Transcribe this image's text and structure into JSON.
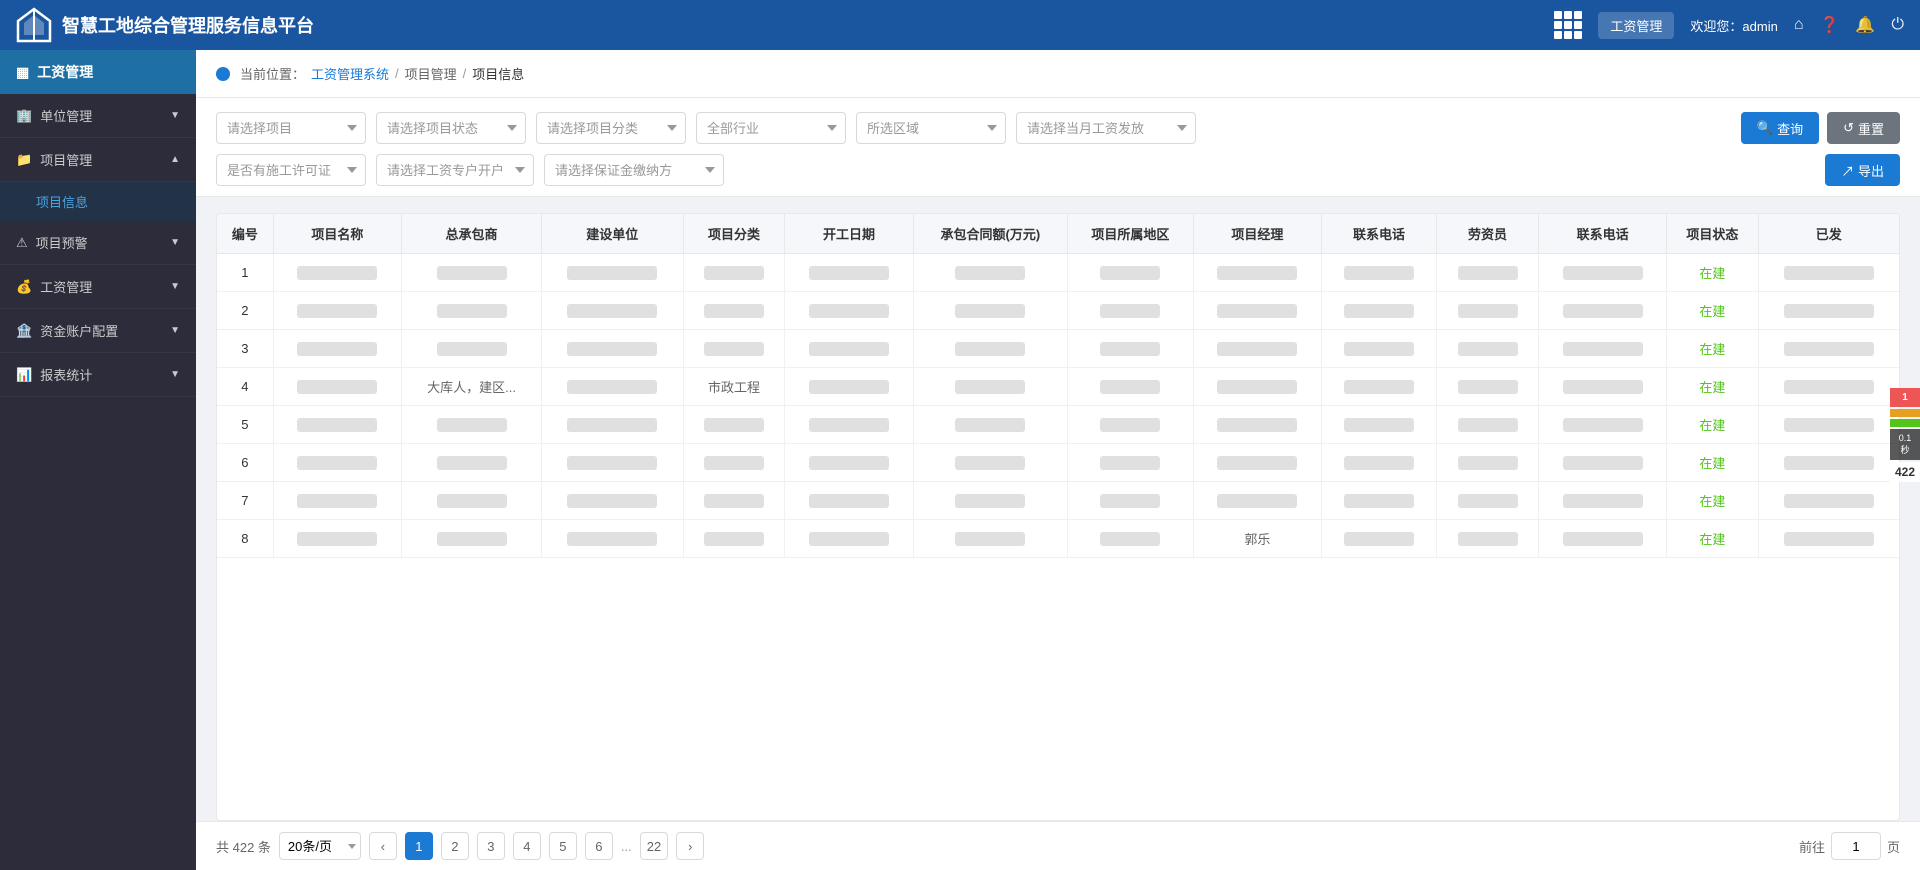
{
  "header": {
    "title": "智慧工地综合管理服务信息平台",
    "module_label": "工资管理",
    "welcome": "欢迎您：admin"
  },
  "sidebar": {
    "top_label": "工资管理",
    "items": [
      {
        "id": "unit-mgmt",
        "label": "单位管理",
        "icon": "building",
        "has_sub": true,
        "expanded": false
      },
      {
        "id": "project-mgmt",
        "label": "项目管理",
        "icon": "project",
        "has_sub": true,
        "expanded": true,
        "sub_items": [
          {
            "id": "project-info",
            "label": "项目信息",
            "active": true
          },
          {
            "id": "project-warning",
            "label": "项目预警"
          }
        ]
      },
      {
        "id": "project-warning-top",
        "label": "项目预警",
        "icon": "warning",
        "has_sub": true,
        "expanded": false
      },
      {
        "id": "wage-mgmt",
        "label": "工资管理",
        "icon": "wage",
        "has_sub": true,
        "expanded": false
      },
      {
        "id": "account-config",
        "label": "资金账户配置",
        "icon": "account",
        "has_sub": true,
        "expanded": false
      },
      {
        "id": "report-stats",
        "label": "报表统计",
        "icon": "report",
        "has_sub": true,
        "expanded": false
      }
    ]
  },
  "breadcrumb": {
    "items": [
      "工资管理系统",
      "项目管理",
      "项目信息"
    ]
  },
  "filters": {
    "row1": [
      {
        "id": "select-project",
        "placeholder": "请选择项目"
      },
      {
        "id": "select-status",
        "placeholder": "请选择项目状态"
      },
      {
        "id": "select-category",
        "placeholder": "请选择项目分类"
      },
      {
        "id": "select-industry",
        "placeholder": "全部行业"
      },
      {
        "id": "select-area",
        "placeholder": "所选区域"
      },
      {
        "id": "select-wage-date",
        "placeholder": "请选择当月工资发放"
      }
    ],
    "row2": [
      {
        "id": "select-permit",
        "placeholder": "是否有施工许可证"
      },
      {
        "id": "select-wage-account",
        "placeholder": "请选择工资专户开户"
      },
      {
        "id": "select-guarantee",
        "placeholder": "请选择保证金缴纳方"
      }
    ],
    "query_btn": "查询",
    "reset_btn": "重置",
    "export_btn": "导出"
  },
  "table": {
    "columns": [
      "编号",
      "项目名称",
      "总承包商",
      "建设单位",
      "项目分类",
      "开工日期",
      "承包合同额(万元)",
      "项目所属地区",
      "项目经理",
      "联系电话",
      "劳资员",
      "联系电话",
      "项目状态",
      "已发"
    ],
    "rows": [
      {
        "no": 1,
        "status": "在建"
      },
      {
        "no": 2,
        "status": "在建"
      },
      {
        "no": 3,
        "status": "在建"
      },
      {
        "no": 4,
        "contractor": "大库人，建区...",
        "category": "市政工程",
        "status": "在建"
      },
      {
        "no": 5,
        "status": "在建"
      },
      {
        "no": 6,
        "status": "在建"
      },
      {
        "no": 7,
        "status": "在建"
      },
      {
        "no": 8,
        "manager": "郭乐",
        "status": "在建"
      }
    ]
  },
  "pagination": {
    "total_label": "共 422 条",
    "page_size_label": "20条/页",
    "pages": [
      1,
      2,
      3,
      4,
      5,
      6
    ],
    "ellipsis": "...",
    "last_page": 22,
    "current": 1,
    "goto_label": "前往",
    "goto_value": "1",
    "page_label": "页"
  },
  "right_panel": {
    "items": [
      {
        "label": "1",
        "color": "badge"
      },
      {
        "label": "",
        "color": "orange"
      },
      {
        "label": "",
        "color": "green"
      },
      {
        "label": "0.1",
        "color": "dark"
      },
      {
        "label": "422",
        "color": "badge-white"
      }
    ]
  },
  "icons": {
    "apps_icon": "⊞",
    "home_icon": "⌂",
    "help_icon": "?",
    "bell_icon": "🔔",
    "power_icon": "⏻",
    "search_icon": "🔍",
    "reset_icon": "↺",
    "export_icon": "↗",
    "chevron_down": "▼",
    "chevron_up": "▲",
    "prev_icon": "‹",
    "next_icon": "›"
  }
}
